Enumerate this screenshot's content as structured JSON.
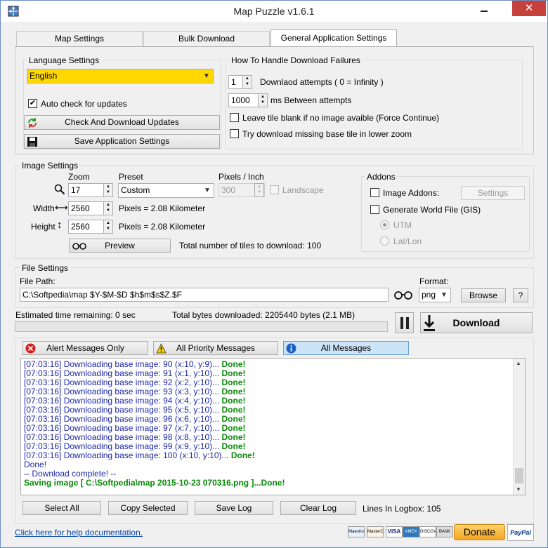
{
  "window": {
    "title": "Map Puzzle v1.6.1",
    "close_glyph": "✕"
  },
  "tabs": [
    {
      "label": "Map Settings"
    },
    {
      "label": "Bulk Download"
    },
    {
      "label": "General Application Settings"
    }
  ],
  "language": {
    "group_label": "Language Settings",
    "selected": "English",
    "auto_check_label": "Auto check for updates",
    "auto_check_checked": true,
    "check_updates_button": "Check And Download Updates",
    "save_settings_button": "Save Application Settings"
  },
  "failures": {
    "group_label": "How To Handle Download Failures",
    "attempts_value": "1",
    "attempts_label": "Downlaod attempts ( 0 = Infinity )",
    "ms_value": "1000",
    "ms_label": "ms Between attempts",
    "leave_blank_label": "Leave tile blank if no image avaible (Force Continue)",
    "try_lower_label": "Try download missing base tile in lower zoom"
  },
  "image_settings": {
    "group_label": "Image Settings",
    "zoom_label": "Zoom",
    "zoom_value": "17",
    "preset_label": "Preset",
    "preset_value": "Custom",
    "ppi_label": "Pixels / Inch",
    "ppi_value": "300",
    "landscape_label": "Landscape",
    "width_label": "Width",
    "width_value": "2560",
    "width_km": "Pixels = 2.08 Kilometer",
    "height_label": "Height",
    "height_value": "2560",
    "height_km": "Pixels = 2.08 Kilometer",
    "preview_button": "Preview",
    "total_tiles": "Total number of tiles to download: 100"
  },
  "addons": {
    "group_label": "Addons",
    "image_addons_label": "Image Addons:",
    "settings_button": "Settings",
    "world_file_label": "Generate World File (GIS)",
    "utm_label": "UTM",
    "latlon_label": "Lat/Lon"
  },
  "file_settings": {
    "group_label": "File Settings",
    "path_label": "File Path:",
    "path_value": "C:\\Softpedia\\map $Y-$M-$D $h$m$s$Z.$F",
    "format_label": "Format:",
    "format_value": "png",
    "browse_button": "Browse",
    "help_button": "?"
  },
  "status": {
    "time_remaining": "Estimated time remaining: 0 sec",
    "bytes_downloaded": "Total bytes downloaded: 2205440 bytes (2.1 MB)",
    "download_button": "Download",
    "progress_fraction": 0
  },
  "filters": {
    "alert": "Alert Messages Only",
    "priority": "All Priority Messages",
    "all": "All Messages"
  },
  "log": {
    "lines": [
      {
        "text": "[07:03:16] Downloading base image: 90 (x:10, y:9)...",
        "status": "Done!"
      },
      {
        "text": "[07:03:16] Downloading base image: 91 (x:1, y:10)...",
        "status": "Done!"
      },
      {
        "text": "[07:03:16] Downloading base image: 92 (x:2, y:10)...",
        "status": "Done!"
      },
      {
        "text": "[07:03:16] Downloading base image: 93 (x:3, y:10)...",
        "status": "Done!"
      },
      {
        "text": "[07:03:16] Downloading base image: 94 (x:4, y:10)...",
        "status": "Done!"
      },
      {
        "text": "[07:03:16] Downloading base image: 95 (x:5, y:10)...",
        "status": "Done!"
      },
      {
        "text": "[07:03:16] Downloading base image: 96 (x:6, y:10)...",
        "status": "Done!"
      },
      {
        "text": "[07:03:16] Downloading base image: 97 (x:7, y:10)...",
        "status": "Done!"
      },
      {
        "text": "[07:03:16] Downloading base image: 98 (x:8, y:10)...",
        "status": "Done!"
      },
      {
        "text": "[07:03:16] Downloading base image: 99 (x:9, y:10)...",
        "status": "Done!"
      },
      {
        "text": "[07:03:16] Downloading base image: 100 (x:10, y:10)...",
        "status": "Done!"
      }
    ],
    "done": "Done!",
    "complete": "-- Download complete! --",
    "saving": "Saving image [ C:\\Softpedia\\map 2015-10-23 070316.png ]...Done!"
  },
  "bottom": {
    "select_all": "Select All",
    "copy_selected": "Copy Selected",
    "save_log": "Save Log",
    "clear_log": "Clear Log",
    "lines_in_logbox": "Lines In Logbox: 105",
    "help_link": "Click here for help documentation.",
    "donate": "Donate",
    "paypal": "PayPal",
    "cards": [
      "Maestro",
      "MasterCard",
      "VISA",
      "AMEX",
      "DISCOVER",
      "BANK"
    ]
  },
  "colors": {
    "language_select_bg": "#ffd800",
    "all_messages_active": "#cce4f7",
    "donate_bg": "#f7b51d"
  }
}
